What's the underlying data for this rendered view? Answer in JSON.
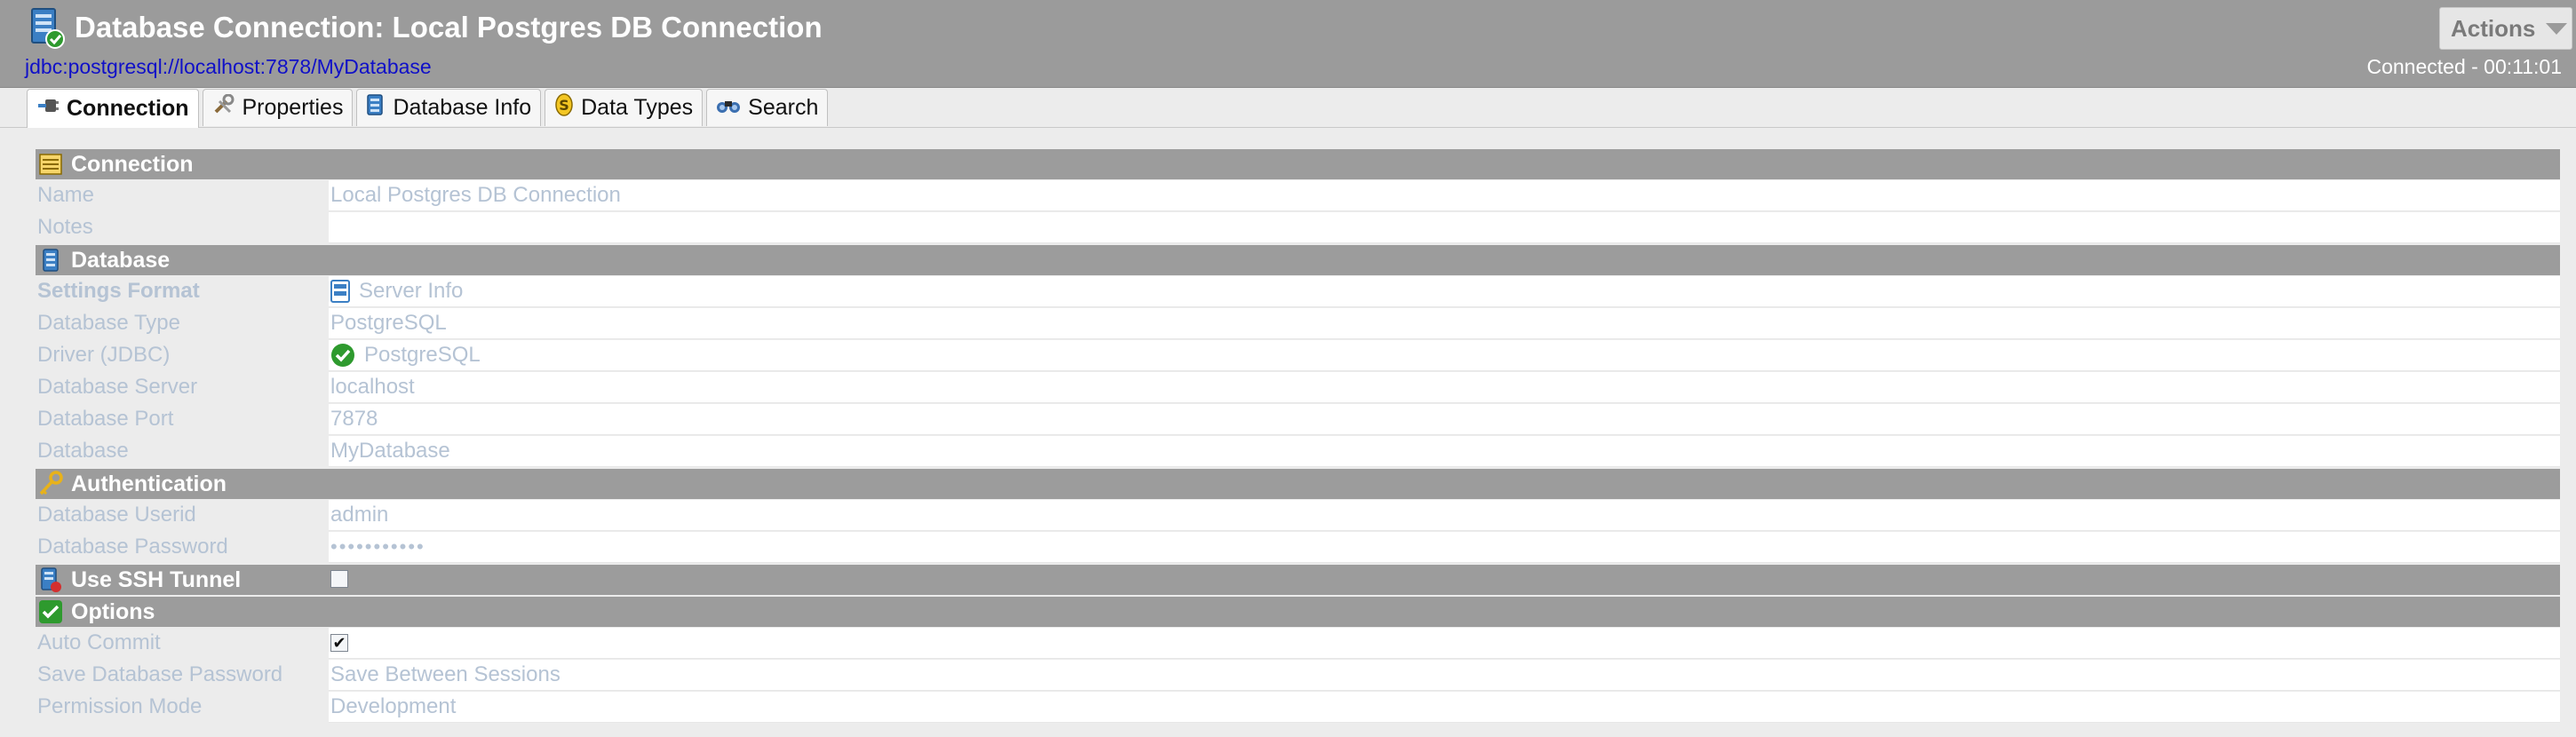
{
  "header": {
    "title": "Database Connection: Local Postgres DB Connection",
    "url": "jdbc:postgresql://localhost:7878/MyDatabase",
    "status": "Connected - 00:11:01",
    "actions_label": "Actions"
  },
  "tabs": [
    {
      "label": "Connection",
      "icon": "connection-plug-icon",
      "active": true
    },
    {
      "label": "Properties",
      "icon": "tools-icon",
      "active": false
    },
    {
      "label": "Database Info",
      "icon": "database-info-icon",
      "active": false
    },
    {
      "label": "Data Types",
      "icon": "data-types-icon",
      "active": false
    },
    {
      "label": "Search",
      "icon": "binoculars-icon",
      "active": false
    }
  ],
  "sections": {
    "connection": {
      "title": "Connection",
      "icon": "notepad-icon",
      "name_label": "Name",
      "name_value": "Local Postgres DB Connection",
      "notes_label": "Notes",
      "notes_value": ""
    },
    "database": {
      "title": "Database",
      "icon": "database-icon",
      "settings_format_label": "Settings Format",
      "settings_format_value": "Server Info",
      "database_type_label": "Database Type",
      "database_type_value": "PostgreSQL",
      "driver_label": "Driver (JDBC)",
      "driver_value": "PostgreSQL",
      "server_label": "Database Server",
      "server_value": "localhost",
      "port_label": "Database Port",
      "port_value": "7878",
      "database_label": "Database",
      "database_value": "MyDatabase"
    },
    "authentication": {
      "title": "Authentication",
      "icon": "key-icon",
      "userid_label": "Database Userid",
      "userid_value": "admin",
      "password_label": "Database Password",
      "password_value": "•••••••••••"
    },
    "ssh": {
      "title": "Use SSH Tunnel",
      "icon": "ssh-tunnel-icon",
      "checked": false
    },
    "options": {
      "title": "Options",
      "icon": "checkmark-icon",
      "auto_commit_label": "Auto Commit",
      "auto_commit_checked": true,
      "save_password_label": "Save Database Password",
      "save_password_value": "Save Between Sessions",
      "permission_mode_label": "Permission Mode",
      "permission_mode_value": "Development"
    }
  },
  "colors": {
    "header_bg": "#9b9b9b",
    "section_bg": "#9c9c9c",
    "label_text": "#b5c3d4",
    "url_text": "#1010c8",
    "success_green": "#2e9a2e"
  }
}
